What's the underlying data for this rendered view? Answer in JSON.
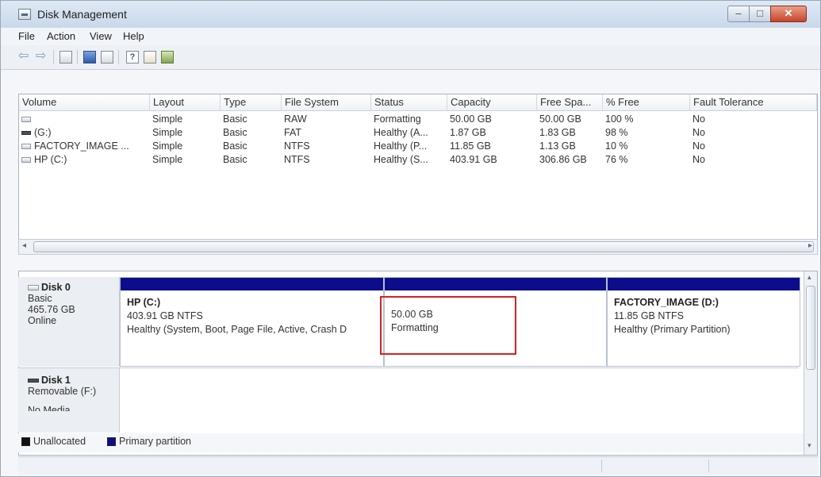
{
  "window": {
    "title": "Disk Management"
  },
  "menu": [
    "File",
    "Action",
    "View",
    "Help"
  ],
  "toolbar": {
    "icons": [
      "back-arrow-icon",
      "forward-arrow-icon",
      "console-tree-icon",
      "disk-list-icon",
      "disk-view-icon",
      "help-icon",
      "properties-icon",
      "disk-icon"
    ]
  },
  "volumes": {
    "headers": [
      "Volume",
      "Layout",
      "Type",
      "File System",
      "Status",
      "Capacity",
      "Free Spa...",
      "% Free",
      "Fault Tolerance"
    ],
    "rows": [
      {
        "volume": "",
        "layout": "Simple",
        "type": "Basic",
        "fs": "RAW",
        "status": "Formatting",
        "capacity": "50.00 GB",
        "free": "50.00 GB",
        "pct": "100 %",
        "fault": "No"
      },
      {
        "volume": "(G:)",
        "layout": "Simple",
        "type": "Basic",
        "fs": "FAT",
        "status": "Healthy (A...",
        "capacity": "1.87 GB",
        "free": "1.83 GB",
        "pct": "98 %",
        "fault": "No"
      },
      {
        "volume": "FACTORY_IMAGE ...",
        "layout": "Simple",
        "type": "Basic",
        "fs": "NTFS",
        "status": "Healthy (P...",
        "capacity": "11.85 GB",
        "free": "1.13 GB",
        "pct": "10 %",
        "fault": "No"
      },
      {
        "volume": "HP (C:)",
        "layout": "Simple",
        "type": "Basic",
        "fs": "NTFS",
        "status": "Healthy (S...",
        "capacity": "403.91 GB",
        "free": "306.86 GB",
        "pct": "76 %",
        "fault": "No"
      }
    ]
  },
  "disks": [
    {
      "name": "Disk 0",
      "kind": "Basic",
      "size": "465.76 GB",
      "state": "Online",
      "partitions": [
        {
          "title": "HP  (C:)",
          "size": "403.91 GB NTFS",
          "status": "Healthy (System, Boot, Page File, Active, Crash D"
        },
        {
          "title": "",
          "size": "50.00 GB",
          "status": "Formatting"
        },
        {
          "title": "FACTORY_IMAGE  (D:)",
          "size": "11.85 GB NTFS",
          "status": "Healthy (Primary Partition)"
        }
      ]
    },
    {
      "name": "Disk 1",
      "kind": "Removable (F:)",
      "size": "No Media",
      "state": ""
    }
  ],
  "legend": [
    {
      "label": "Unallocated",
      "color": "#111111"
    },
    {
      "label": "Primary partition",
      "color": "#0d0d8c"
    }
  ],
  "colors": {
    "primary_partition": "#0d0d8c",
    "highlight": "#d9201f"
  }
}
